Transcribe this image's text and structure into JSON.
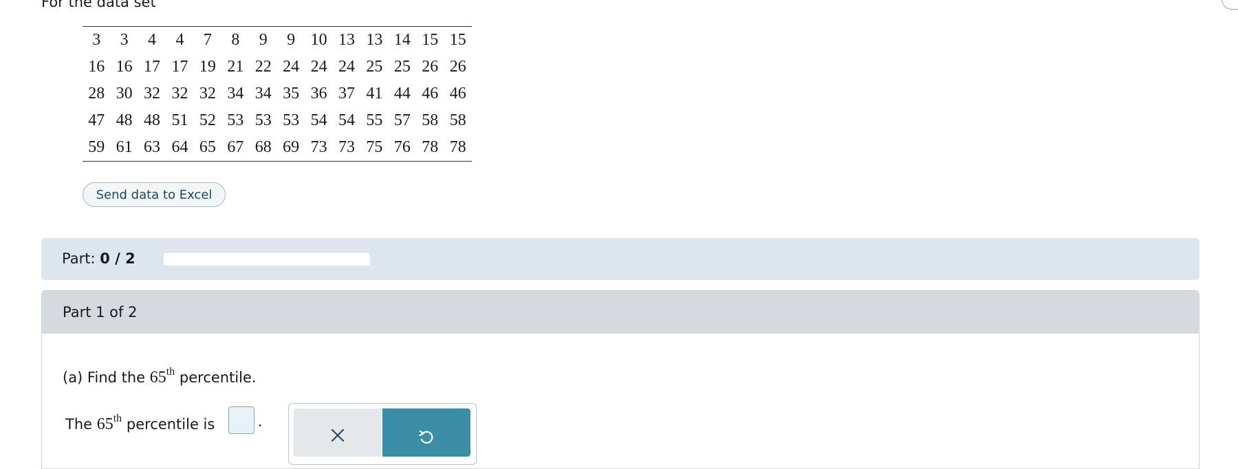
{
  "intro": {
    "text": "For the data set"
  },
  "dataset": {
    "rows": [
      [
        "3",
        "3",
        "4",
        "4",
        "7",
        "8",
        "9",
        "9",
        "10",
        "13",
        "13",
        "14",
        "15",
        "15"
      ],
      [
        "16",
        "16",
        "17",
        "17",
        "19",
        "21",
        "22",
        "24",
        "24",
        "24",
        "25",
        "25",
        "26",
        "26"
      ],
      [
        "28",
        "30",
        "32",
        "32",
        "32",
        "34",
        "34",
        "35",
        "36",
        "37",
        "41",
        "44",
        "46",
        "46"
      ],
      [
        "47",
        "48",
        "48",
        "51",
        "52",
        "53",
        "53",
        "53",
        "54",
        "54",
        "55",
        "57",
        "58",
        "58"
      ],
      [
        "59",
        "61",
        "63",
        "64",
        "65",
        "67",
        "68",
        "69",
        "73",
        "73",
        "75",
        "76",
        "78",
        "78"
      ]
    ]
  },
  "excel_button": {
    "label": "Send data to Excel"
  },
  "part_progress": {
    "label": "Part:",
    "value_text": "0 / 2",
    "completed": 0,
    "total": 2,
    "fill_color": "#2e7c91"
  },
  "part_panel": {
    "title": "Part 1 of 2",
    "question": {
      "prefix": "(a) Find the ",
      "number": "65",
      "suffix_sup": "th",
      "rest": " percentile."
    },
    "answer": {
      "prefix": "The ",
      "number": "65",
      "suffix_sup": "th",
      "rest": " percentile is",
      "value": "",
      "period": "."
    }
  },
  "tools": {
    "clear_icon": "close-icon",
    "undo_icon": "undo-icon",
    "undo_color": "#3a8ea7"
  },
  "colors": {
    "part_bar_bg": "#dde6ef",
    "panel_header_bg": "#d4dadd",
    "input_bg": "#e6f2f8"
  }
}
